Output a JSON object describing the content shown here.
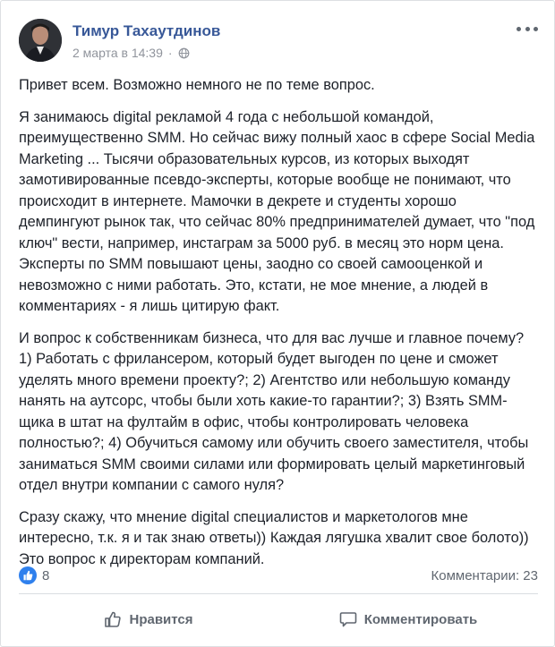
{
  "post": {
    "author": "Тимур Тахаутдинов",
    "date": "2 марта в 14:39",
    "paragraphs": [
      "Привет всем. Возможно немного не по теме вопрос.",
      "Я занимаюсь digital рекламой 4 года с небольшой командой, преимущественно SMM. Но сейчас вижу полный хаос в сфере Social Media Marketing ... Тысячи образовательных курсов, из которых выходят замотивированные псевдо-эксперты, которые вообще не понимают, что происходит в интернете. Мамочки в декрете и студенты хорошо демпингуют рынок так, что сейчас 80% предпринимателей думает, что \"под ключ\" вести, например, инстаграм за 5000 руб. в месяц это норм цена. Эксперты по SMM повышают цены, заодно со своей самооценкой и невозможно с ними работать. Это, кстати, не мое мнение, а людей в комментариях - я лишь цитирую факт.",
      "И вопрос к собственникам бизнеса, что для вас лучше и главное почему? 1) Работать с фрилансером, который будет выгоден по цене и сможет уделять много времени проекту?; 2) Агентство или небольшую команду нанять на аутсорс, чтобы были хоть какие-то гарантии?; 3) Взять SMM-щика в штат на фултайм в офис, чтобы контролировать человека полностью?; 4) Обучиться самому или обучить своего заместителя, чтобы заниматься SMM своими силами или формировать целый маркетинговый отдел внутри компании с самого нуля?",
      "Сразу скажу, что мнение digital специалистов и маркетологов мне интересно, т.к. я и так знаю ответы)) Каждая лягушка хвалит свое болото)) Это вопрос к директорам компаний."
    ]
  },
  "stats": {
    "likes": "8",
    "comments": "Комментарии: 23"
  },
  "actions": {
    "like_label": "Нравится",
    "comment_label": "Комментировать"
  },
  "colors": {
    "author": "#385898",
    "muted": "#90949c",
    "like_badge": "#2f80ed"
  },
  "icons": {
    "more": "more-options-icon",
    "globe": "globe-icon",
    "like_badge": "thumbs-up-badge-icon",
    "like_action": "thumbs-up-outline-icon",
    "comment_action": "speech-bubble-icon"
  }
}
